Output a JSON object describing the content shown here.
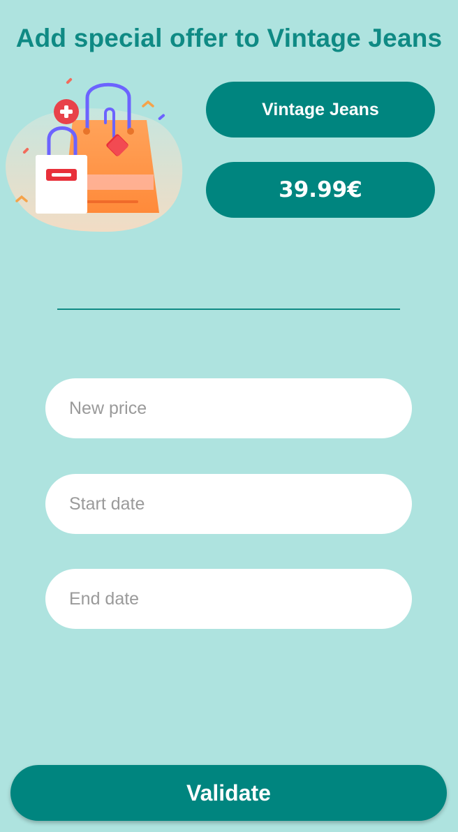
{
  "header": {
    "title": "Add special offer to Vintage Jeans"
  },
  "product": {
    "name": "Vintage Jeans",
    "price": "39.99€",
    "illustration_icon": "shopping-bags-icon"
  },
  "form": {
    "new_price_placeholder": "New price",
    "start_date_placeholder": "Start date",
    "end_date_placeholder": "End date",
    "new_price_value": "",
    "start_date_value": "",
    "end_date_value": ""
  },
  "actions": {
    "validate_label": "Validate"
  },
  "colors": {
    "background": "#aee3df",
    "accent": "#00857f",
    "title": "#0f8a84",
    "field_bg": "#ffffff",
    "placeholder": "#9a9a9a"
  }
}
